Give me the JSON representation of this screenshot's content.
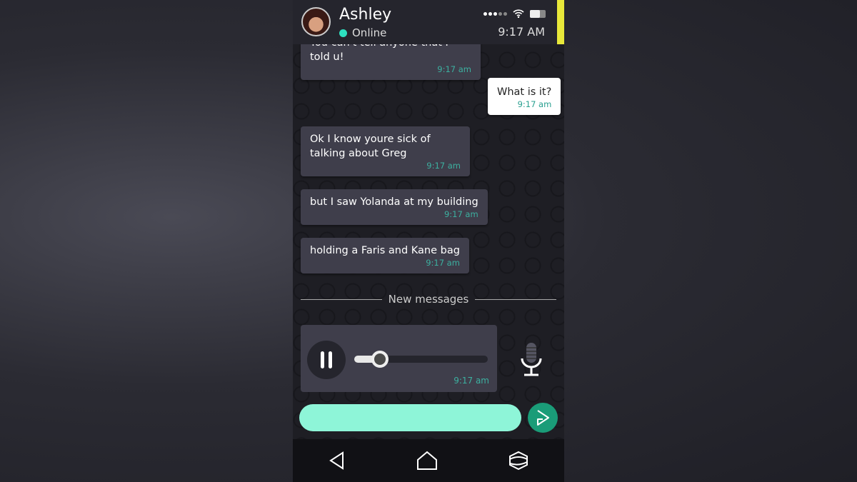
{
  "contact": {
    "name": "Ashley",
    "status": "Online"
  },
  "status_bar": {
    "time": "9:17 AM",
    "icons": [
      "signal-icon",
      "wifi-icon",
      "battery-icon"
    ]
  },
  "messages": [
    {
      "direction": "in",
      "text": "You can't tell anyone that I told u!",
      "time": "9:17 am"
    },
    {
      "direction": "out",
      "text": "What is it?",
      "time": "9:17 am"
    },
    {
      "direction": "in",
      "text": "Ok I know youre sick of talking about Greg",
      "time": "9:17 am"
    },
    {
      "direction": "in",
      "text": "but I saw Yolanda at my building",
      "time": "9:17 am"
    },
    {
      "direction": "in",
      "text": "holding a Faris and Kane bag",
      "time": "9:17 am"
    }
  ],
  "divider": "New messages",
  "voice_message": {
    "time": "9:17 am",
    "progress_percent": 19,
    "state": "playing"
  },
  "composer": {
    "value": "",
    "placeholder": ""
  },
  "colors": {
    "accent": "#8ef5d8",
    "send": "#1a9c78",
    "timestamp": "#3cb0a0",
    "highlight": "#e8e83a"
  }
}
